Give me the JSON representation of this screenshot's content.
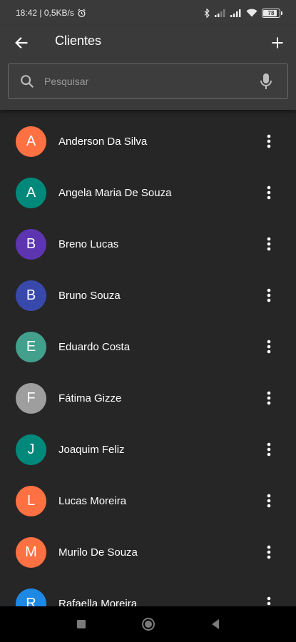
{
  "status_bar": {
    "left_text": "18:42 | 0,5KB/s",
    "battery": "78",
    "battery_level": 0.78,
    "icons": [
      "alarm-icon",
      "bluetooth-icon",
      "signal-icon",
      "signal-icon",
      "wifi-icon",
      "battery-icon"
    ]
  },
  "app_bar": {
    "title": "Clientes",
    "back_icon": "arrow-left-icon",
    "add_icon": "plus-icon"
  },
  "search": {
    "placeholder": "Pesquisar",
    "value": "",
    "search_icon": "search-icon",
    "mic_icon": "microphone-icon"
  },
  "clients": [
    {
      "initial": "A",
      "name": "Anderson Da Silva",
      "color": "#FF7043"
    },
    {
      "initial": "A",
      "name": "Angela Maria De Souza",
      "color": "#00897B"
    },
    {
      "initial": "B",
      "name": "Breno Lucas",
      "color": "#5E35B1"
    },
    {
      "initial": "B",
      "name": "Bruno Souza",
      "color": "#3949AB"
    },
    {
      "initial": "E",
      "name": "Eduardo Costa",
      "color": "#43A08C"
    },
    {
      "initial": "F",
      "name": "Fátima Gizze",
      "color": "#9E9E9E"
    },
    {
      "initial": "J",
      "name": "Joaquim Feliz",
      "color": "#00897B"
    },
    {
      "initial": "L",
      "name": "Lucas Moreira",
      "color": "#FF7043"
    },
    {
      "initial": "M",
      "name": "Murilo De Souza",
      "color": "#FF7043"
    },
    {
      "initial": "R",
      "name": "Rafaella Moreira",
      "color": "#1E88E5"
    }
  ],
  "item_menu_icon": "more-vertical-icon",
  "nav_bar": {
    "buttons": [
      "recent-apps-icon",
      "home-icon",
      "back-icon"
    ]
  },
  "colors": {
    "background": "#262626",
    "app_bar": "#3a3a3a",
    "nav_bar": "#000000"
  }
}
